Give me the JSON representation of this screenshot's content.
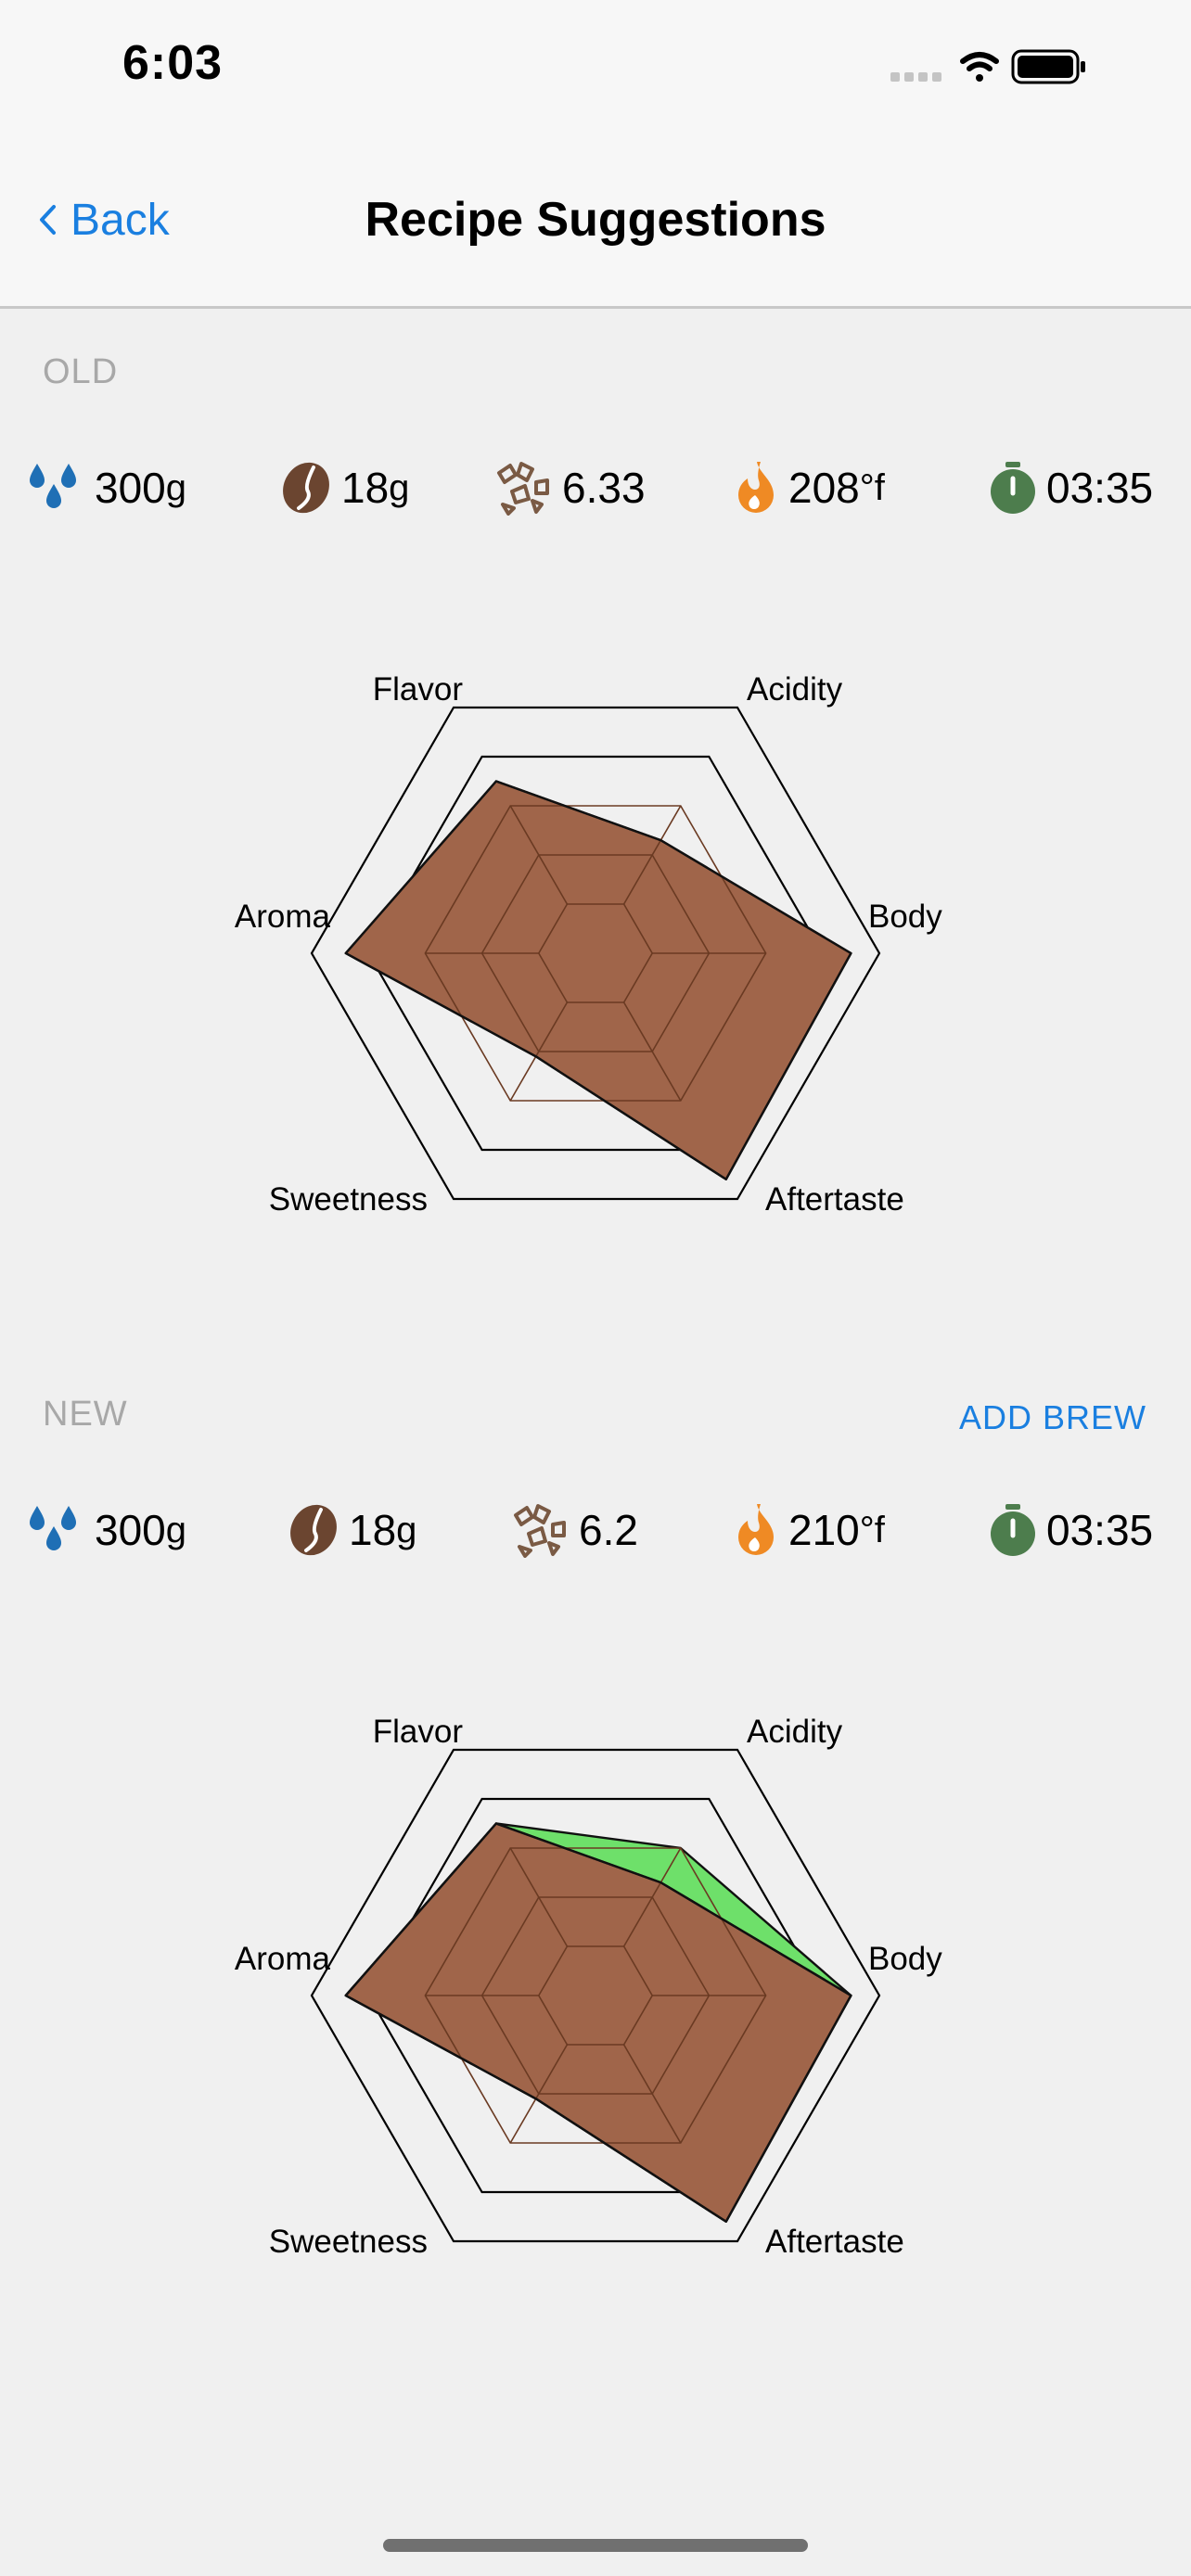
{
  "status_bar": {
    "time": "6:03"
  },
  "nav": {
    "back_label": "Back",
    "title": "Recipe Suggestions"
  },
  "colors": {
    "accent": "#1a7fe0",
    "water": "#1f6fb5",
    "coffee": "#6b4530",
    "grind": "#7a5a44",
    "temp": "#ef8a24",
    "timer": "#4d7d4d",
    "profile_fill": "#a0654a",
    "improvement_fill": "#6ee06a"
  },
  "old": {
    "label": "OLD",
    "metrics": {
      "water": "300",
      "water_unit": "g",
      "coffee": "18",
      "coffee_unit": "g",
      "grind": "6.33",
      "temp": "208",
      "temp_unit": "°f",
      "time": "03:35"
    }
  },
  "new": {
    "label": "NEW",
    "add_brew": "ADD BREW",
    "metrics": {
      "water": "300",
      "water_unit": "g",
      "coffee": "18",
      "coffee_unit": "g",
      "grind": "6.2",
      "temp": "210",
      "temp_unit": "°f",
      "time": "03:35"
    }
  },
  "chart_data": [
    {
      "type": "radar",
      "axes": [
        "Acidity",
        "Body",
        "Aftertaste",
        "Sweetness",
        "Aroma",
        "Flavor"
      ],
      "max": 5,
      "series": [
        {
          "values": [
            2.3,
            4.5,
            4.6,
            2.1,
            4.4,
            3.5
          ]
        }
      ]
    },
    {
      "type": "radar",
      "axes": [
        "Acidity",
        "Body",
        "Aftertaste",
        "Sweetness",
        "Aroma",
        "Flavor"
      ],
      "max": 5,
      "series": [
        {
          "values": [
            3.0,
            4.5,
            4.6,
            2.1,
            4.4,
            3.5
          ]
        },
        {
          "values": [
            2.3,
            4.5,
            4.6,
            2.1,
            4.4,
            3.5
          ]
        }
      ]
    }
  ]
}
